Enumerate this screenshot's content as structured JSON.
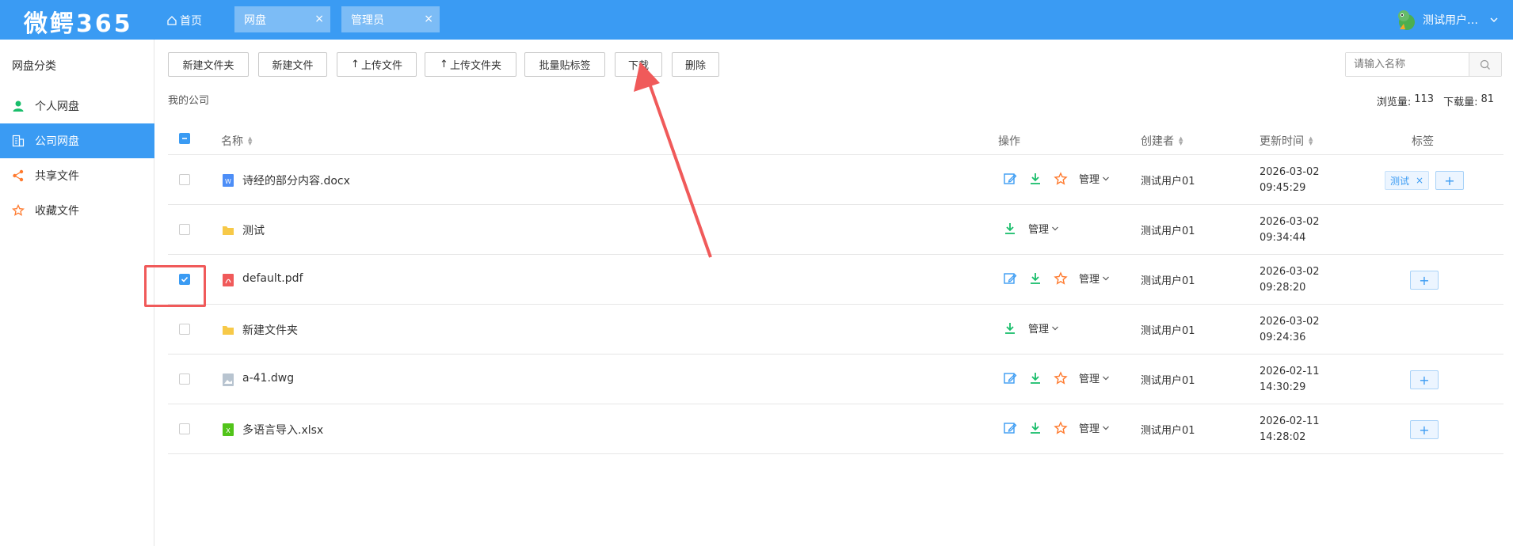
{
  "header": {
    "logo": "微鳄365",
    "home_label": "首页",
    "tabs": [
      {
        "label": "网盘"
      },
      {
        "label": "管理员"
      }
    ],
    "user_name": "测试用户…"
  },
  "sidebar": {
    "title": "网盘分类",
    "items": [
      {
        "label": "个人网盘",
        "icon": "user-icon"
      },
      {
        "label": "公司网盘",
        "icon": "building-icon",
        "active": true
      },
      {
        "label": "共享文件",
        "icon": "share-icon"
      },
      {
        "label": "收藏文件",
        "icon": "star-icon"
      }
    ]
  },
  "toolbar": {
    "new_folder": "新建文件夹",
    "new_file": "新建文件",
    "upload_file": "上传文件",
    "upload_folder": "上传文件夹",
    "batch_tag": "批量贴标签",
    "download": "下载",
    "delete": "删除"
  },
  "search": {
    "placeholder": "请输入名称"
  },
  "breadcrumb": "我的公司",
  "stats": {
    "views_label": "浏览量:",
    "views": "113",
    "downloads_label": "下载量:",
    "downloads": "81"
  },
  "table": {
    "headers": {
      "name": "名称",
      "ops": "操作",
      "creator": "创建者",
      "updated": "更新时间",
      "tags": "标签"
    },
    "manage_label": "管理",
    "rows": [
      {
        "name": "诗经的部分内容.docx",
        "type": "docx",
        "creator": "测试用户01",
        "date": "2026-03-02",
        "time": "09:45:29",
        "tag": "测试",
        "checked": false
      },
      {
        "name": "测试",
        "type": "folder",
        "creator": "测试用户01",
        "date": "2026-03-02",
        "time": "09:34:44",
        "checked": false
      },
      {
        "name": "default.pdf",
        "type": "pdf",
        "creator": "测试用户01",
        "date": "2026-03-02",
        "time": "09:28:20",
        "checked": true
      },
      {
        "name": "新建文件夹",
        "type": "folder",
        "creator": "测试用户01",
        "date": "2026-03-02",
        "time": "09:24:36",
        "checked": false
      },
      {
        "name": "a-41.dwg",
        "type": "dwg",
        "creator": "测试用户01",
        "date": "2026-02-11",
        "time": "14:30:29",
        "checked": false
      },
      {
        "name": "多语言导入.xlsx",
        "type": "xlsx",
        "creator": "测试用户01",
        "date": "2026-02-11",
        "time": "14:28:02",
        "checked": false
      }
    ]
  },
  "colors": {
    "primary": "#3a9bf3",
    "annotation": "#f05a5a",
    "download": "#19be6b",
    "star": "#ff7a2e"
  }
}
